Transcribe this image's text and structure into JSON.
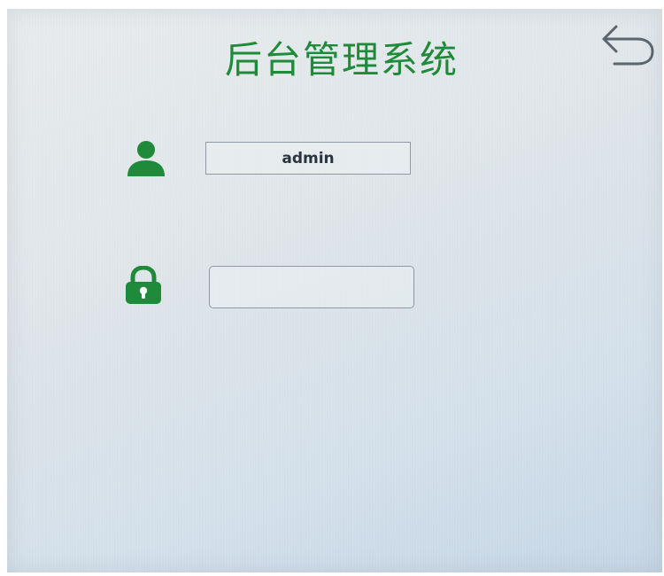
{
  "header": {
    "title": "后台管理系统",
    "back_icon": "back-arrow-icon"
  },
  "login": {
    "username_icon": "user-icon",
    "username_value": "admin",
    "password_icon": "lock-icon",
    "password_value": ""
  },
  "colors": {
    "accent_green": "#1f8a39",
    "field_border": "#8f9aa2",
    "background": "#dfe6ea"
  }
}
